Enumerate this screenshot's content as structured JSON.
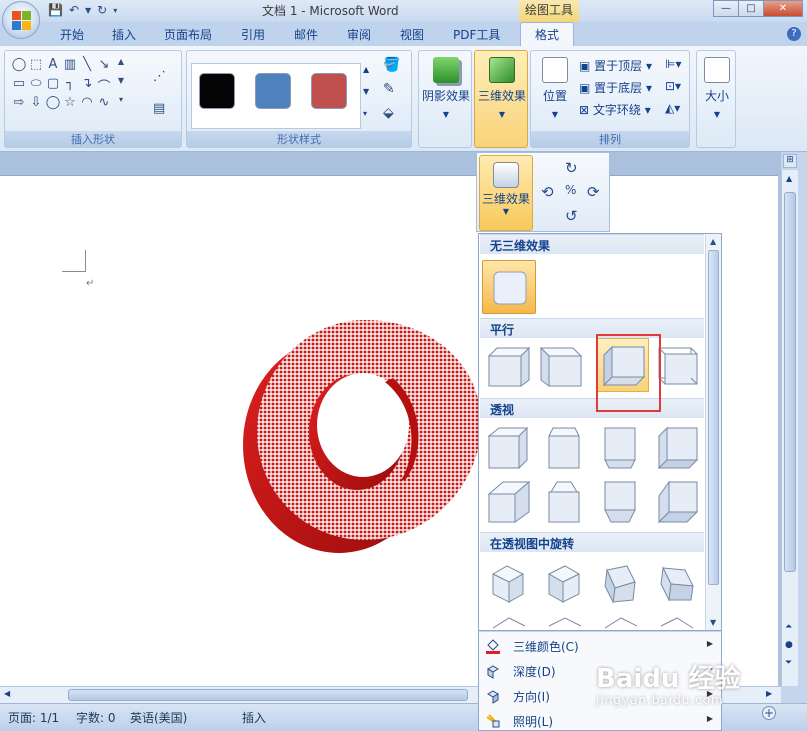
{
  "window": {
    "title": "文档 1 - Microsoft Word",
    "context_tab_group": "绘图工具"
  },
  "tabs": [
    {
      "label": "开始"
    },
    {
      "label": "插入"
    },
    {
      "label": "页面布局"
    },
    {
      "label": "引用"
    },
    {
      "label": "邮件"
    },
    {
      "label": "审阅"
    },
    {
      "label": "视图"
    },
    {
      "label": "PDF工具"
    },
    {
      "label": "格式"
    }
  ],
  "active_tab": "格式",
  "ribbon": {
    "groups": {
      "insert_shapes": "插入形状",
      "shape_styles": "形状样式",
      "arrange": "排列"
    },
    "swatch_colors": [
      "#050505",
      "#4f81bd",
      "#c0504d"
    ],
    "shadow_effects": "阴影效果",
    "threed_effects": "三维效果",
    "position": "位置",
    "bring_to_front": "置于顶层",
    "send_to_back": "置于底层",
    "text_wrapping": "文字环绕",
    "size": "大小"
  },
  "popbar": {
    "threed_effects": "三维效果"
  },
  "gallery": {
    "section_none": "无三维效果",
    "section_parallel": "平行",
    "section_perspective": "透视",
    "section_rotate_perspective": "在透视图中旋转"
  },
  "menu": [
    {
      "label": "三维颜色(C)",
      "icon": "paint-bucket-icon"
    },
    {
      "label": "深度(D)",
      "icon": "depth-icon"
    },
    {
      "label": "方向(I)",
      "icon": "direction-icon"
    },
    {
      "label": "照明(L)",
      "icon": "lighting-icon"
    }
  ],
  "status": {
    "page": "页面: 1/1",
    "words": "字数: 0",
    "language": "英语(美国)",
    "mode": "插入"
  },
  "shape_colors": {
    "torus": "#cc1010",
    "highlight_box": "#e03a3a"
  },
  "watermark": {
    "brand": "Baidu 经验",
    "url": "jingyan.baidu.com"
  }
}
